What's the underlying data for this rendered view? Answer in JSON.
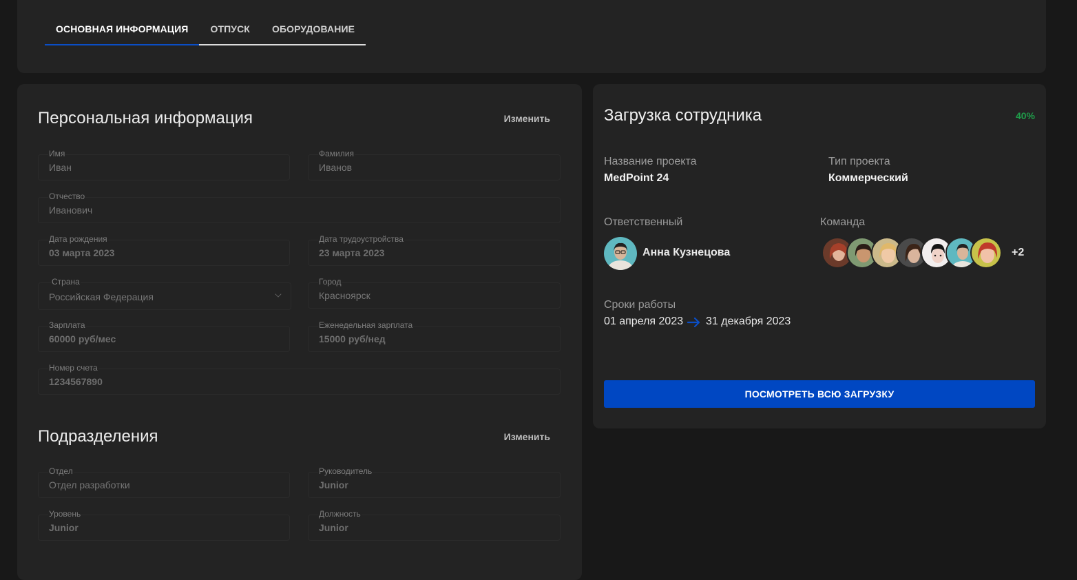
{
  "tabs": [
    {
      "label": "ОСНОВНАЯ ИНФОРМАЦИЯ"
    },
    {
      "label": "ОТПУСК"
    },
    {
      "label": "ОБОРУДОВАНИЕ"
    }
  ],
  "personal": {
    "title": "Персональная информация",
    "edit": "Изменить",
    "fields": {
      "first_name": {
        "label": "Имя",
        "value": "Иван"
      },
      "last_name": {
        "label": "Фамилия",
        "value": "Иванов"
      },
      "patronymic": {
        "label": "Отчество",
        "value": "Иванович"
      },
      "birth_date": {
        "label": "Дата рождения",
        "value": "03 марта 2023"
      },
      "hire_date": {
        "label": "Дата трудоустройства",
        "value": "23 марта 2023"
      },
      "country": {
        "label": "Страна",
        "value": "Российская Федерация"
      },
      "city": {
        "label": "Город",
        "value": "Красноярск"
      },
      "salary": {
        "label": "Зарплата",
        "value": "60000 руб/мес"
      },
      "weekly_salary": {
        "label": "Еженедельная зарплата",
        "value": "15000 руб/нед"
      },
      "account": {
        "label": "Номер счета",
        "value": "1234567890"
      }
    }
  },
  "departments": {
    "title": "Подразделения",
    "edit": "Изменить",
    "fields": {
      "department": {
        "label": "Отдел",
        "value": "Отдел разработки"
      },
      "manager": {
        "label": "Руководитель",
        "value": "Junior"
      },
      "level": {
        "label": "Уровень",
        "value": "Junior"
      },
      "position": {
        "label": "Должность",
        "value": "Junior"
      }
    }
  },
  "workload": {
    "title": "Загрузка сотрудника",
    "percent": "40%",
    "project_name_label": "Название проекта",
    "project_name": "MedPoint 24",
    "project_type_label": "Тип проекта",
    "project_type": "Коммерческий",
    "responsible_label": "Ответственный",
    "responsible_name": "Анна Кузнецова",
    "team_label": "Команда",
    "team_more": "+2",
    "dates_label": "Сроки работы",
    "date_start": "01 апреля 2023",
    "date_end": "31 декабря 2023",
    "button": "ПОСМОТРЕТЬ ВСЮ ЗАГРУЗКУ"
  },
  "colors": {
    "accent": "#0047c2",
    "success": "#1f9d4a",
    "card": "#232323",
    "background": "#181818"
  }
}
